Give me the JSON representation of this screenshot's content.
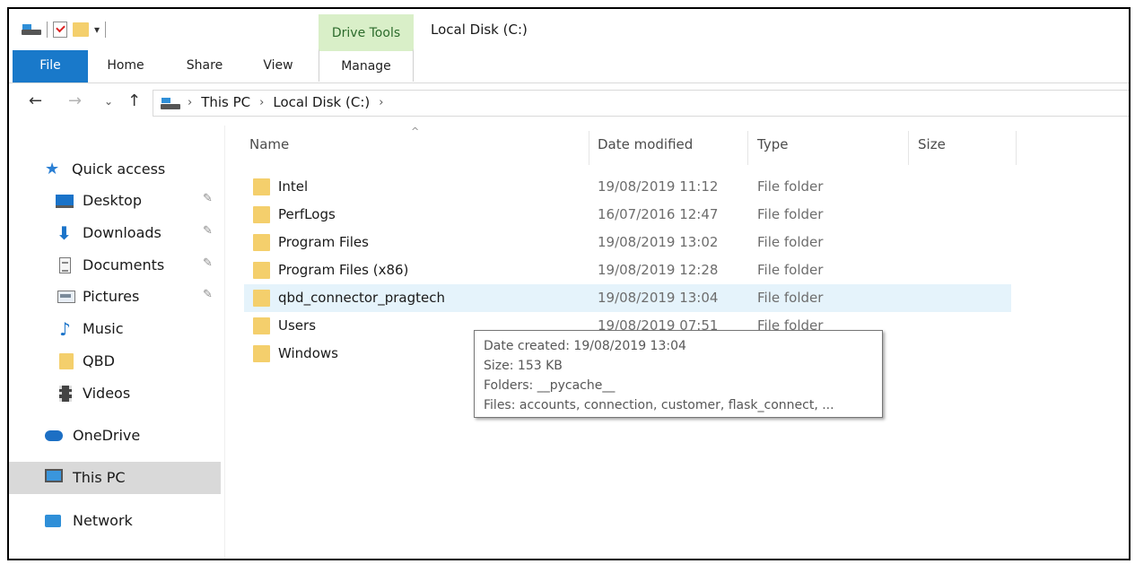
{
  "window": {
    "title": "Local Disk (C:)"
  },
  "context_tab": {
    "label": "Drive Tools"
  },
  "ribbon": {
    "tabs": [
      {
        "label": "File"
      },
      {
        "label": "Home"
      },
      {
        "label": "Share"
      },
      {
        "label": "View"
      },
      {
        "label": "Manage"
      }
    ]
  },
  "address": {
    "crumbs": [
      "This PC",
      "Local Disk (C:)"
    ],
    "separator": "›"
  },
  "nav": {
    "items": [
      {
        "label": "Quick access",
        "icon": "star-icon"
      },
      {
        "label": "Desktop",
        "icon": "desktop-icon",
        "pinned": true
      },
      {
        "label": "Downloads",
        "icon": "download-arrow-icon",
        "pinned": true
      },
      {
        "label": "Documents",
        "icon": "document-icon",
        "pinned": true
      },
      {
        "label": "Pictures",
        "icon": "pictures-icon",
        "pinned": true
      },
      {
        "label": "Music",
        "icon": "music-note-icon"
      },
      {
        "label": "QBD",
        "icon": "folder-icon"
      },
      {
        "label": "Videos",
        "icon": "video-icon"
      },
      {
        "label": "OneDrive",
        "icon": "cloud-icon"
      },
      {
        "label": "This PC",
        "icon": "computer-icon",
        "selected": true
      },
      {
        "label": "Network",
        "icon": "network-icon"
      }
    ]
  },
  "list": {
    "columns": [
      "Name",
      "Date modified",
      "Type",
      "Size"
    ],
    "rows": [
      {
        "name": "Intel",
        "date": "19/08/2019 11:12",
        "type": "File folder"
      },
      {
        "name": "PerfLogs",
        "date": "16/07/2016 12:47",
        "type": "File folder"
      },
      {
        "name": "Program Files",
        "date": "19/08/2019 13:02",
        "type": "File folder"
      },
      {
        "name": "Program Files (x86)",
        "date": "19/08/2019 12:28",
        "type": "File folder"
      },
      {
        "name": "qbd_connector_pragtech",
        "date": "19/08/2019 13:04",
        "type": "File folder",
        "hover": true
      },
      {
        "name": "Users",
        "date": "19/08/2019 07:51",
        "type": "File folder"
      },
      {
        "name": "Windows",
        "date": "",
        "type": ""
      }
    ]
  },
  "tooltip": {
    "lines": [
      "Date created: 19/08/2019 13:04",
      "Size: 153 KB",
      "Folders: __pycache__",
      "Files: accounts, connection, customer, flask_connect, ..."
    ]
  },
  "colors": {
    "file_tab": "#1979ca",
    "drive_tools": "#d9efc8",
    "hover_row": "#e5f3fb",
    "selected_nav": "#d9d9d9",
    "folder": "#f4cf6c"
  }
}
